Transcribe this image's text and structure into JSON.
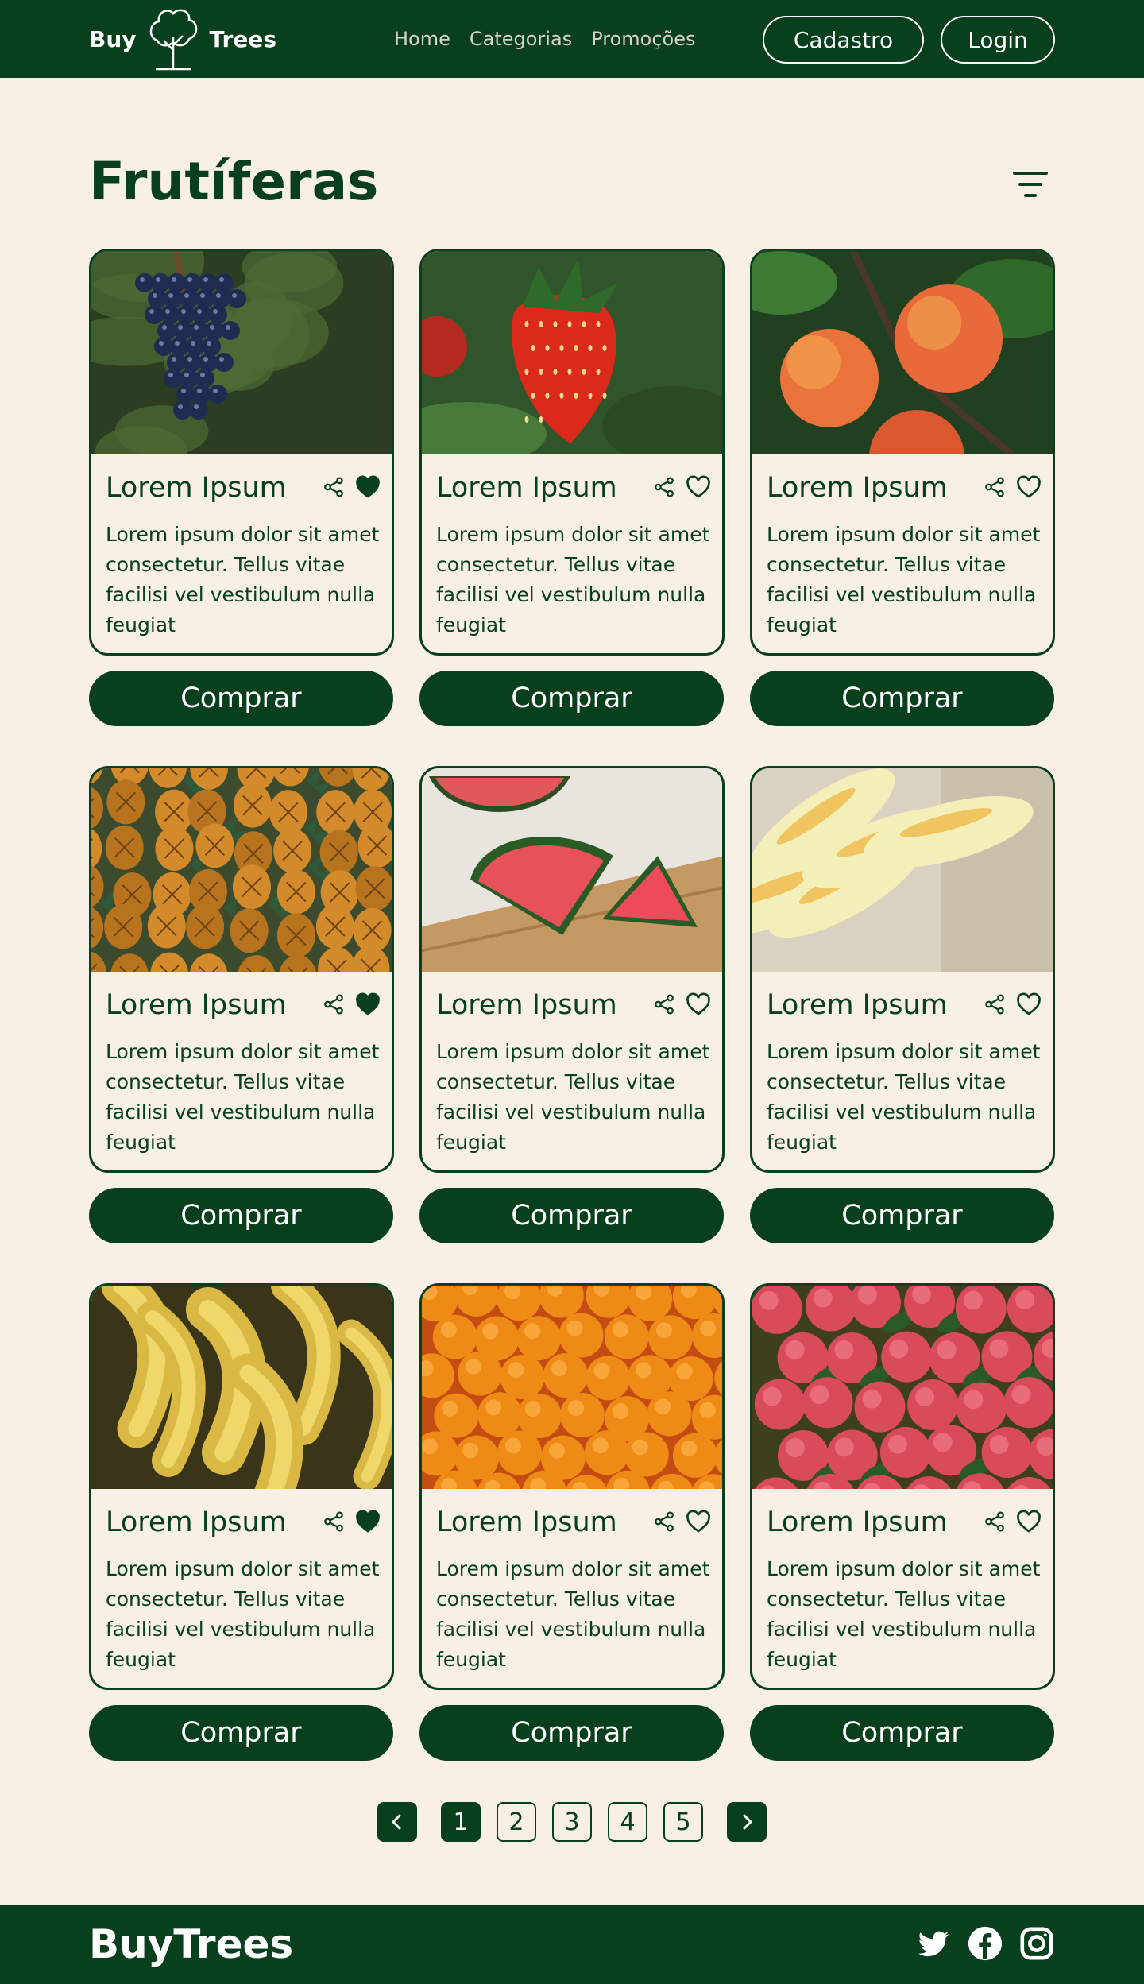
{
  "header": {
    "logo_left": "Buy",
    "logo_right": "Trees",
    "nav": [
      "Home",
      "Categorias",
      "Promoções"
    ],
    "signup_label": "Cadastro",
    "login_label": "Login"
  },
  "page": {
    "title": "Frutíferas"
  },
  "products": [
    {
      "title": "Lorem Ipsum",
      "desc": "Lorem ipsum dolor sit amet consectetur. Tellus vitae facilisi vel vestibulum nulla feugiat",
      "favorited": true,
      "image": "grapes",
      "buy": "Comprar"
    },
    {
      "title": "Lorem Ipsum",
      "desc": "Lorem ipsum dolor sit amet consectetur. Tellus vitae facilisi vel vestibulum nulla feugiat",
      "favorited": false,
      "image": "strawberry",
      "buy": "Comprar"
    },
    {
      "title": "Lorem Ipsum",
      "desc": "Lorem ipsum dolor sit amet consectetur. Tellus vitae facilisi vel vestibulum nulla feugiat",
      "favorited": false,
      "image": "apricots",
      "buy": "Comprar"
    },
    {
      "title": "Lorem Ipsum",
      "desc": "Lorem ipsum dolor sit amet consectetur. Tellus vitae facilisi vel vestibulum nulla feugiat",
      "favorited": true,
      "image": "pineapples",
      "buy": "Comprar"
    },
    {
      "title": "Lorem Ipsum",
      "desc": "Lorem ipsum dolor sit amet consectetur. Tellus vitae facilisi vel vestibulum nulla feugiat",
      "favorited": false,
      "image": "watermelon",
      "buy": "Comprar"
    },
    {
      "title": "Lorem Ipsum",
      "desc": "Lorem ipsum dolor sit amet consectetur. Tellus vitae facilisi vel vestibulum nulla feugiat",
      "favorited": false,
      "image": "melon",
      "buy": "Comprar"
    },
    {
      "title": "Lorem Ipsum",
      "desc": "Lorem ipsum dolor sit amet consectetur. Tellus vitae facilisi vel vestibulum nulla feugiat",
      "favorited": true,
      "image": "bananas",
      "buy": "Comprar"
    },
    {
      "title": "Lorem Ipsum",
      "desc": "Lorem ipsum dolor sit amet consectetur. Tellus vitae facilisi vel vestibulum nulla feugiat",
      "favorited": false,
      "image": "oranges",
      "buy": "Comprar"
    },
    {
      "title": "Lorem Ipsum",
      "desc": "Lorem ipsum dolor sit amet consectetur. Tellus vitae facilisi vel vestibulum nulla feugiat",
      "favorited": false,
      "image": "apples",
      "buy": "Comprar"
    }
  ],
  "pagination": {
    "pages": [
      "1",
      "2",
      "3",
      "4",
      "5"
    ],
    "current": "1",
    "prev_icon": "chevron-left-icon",
    "next_icon": "chevron-right-icon"
  },
  "footer": {
    "brand": "BuyTrees",
    "social": [
      "twitter-icon",
      "facebook-icon",
      "instagram-icon"
    ]
  },
  "colors": {
    "primary": "#08401d",
    "background": "#f8efe5",
    "white": "#ffffff"
  }
}
